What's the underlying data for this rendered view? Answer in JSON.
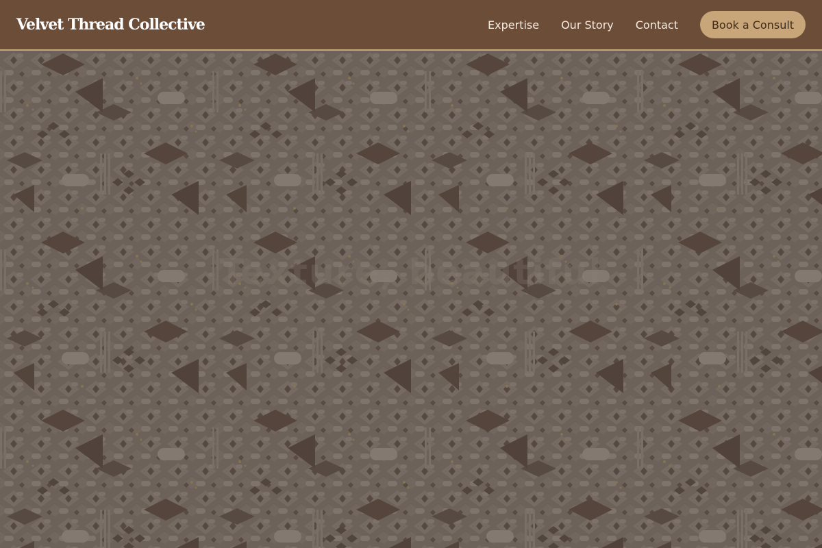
{
  "header": {
    "brand": "Velvet Thread Collective",
    "nav": [
      {
        "label": "Expertise"
      },
      {
        "label": "Our Story"
      },
      {
        "label": "Contact"
      }
    ],
    "cta_label": "Book a Consult"
  },
  "hero": {
    "faded_title": "Texture, beautiful"
  },
  "colors": {
    "header_bg": "#6b4d38",
    "accent": "#c9a679",
    "hero_bg": "#6f645c",
    "pattern_dark": "#4e3f39",
    "pattern_mid": "#7a6f67",
    "pattern_light": "#8a8079",
    "speckle": "#8c7a55"
  }
}
